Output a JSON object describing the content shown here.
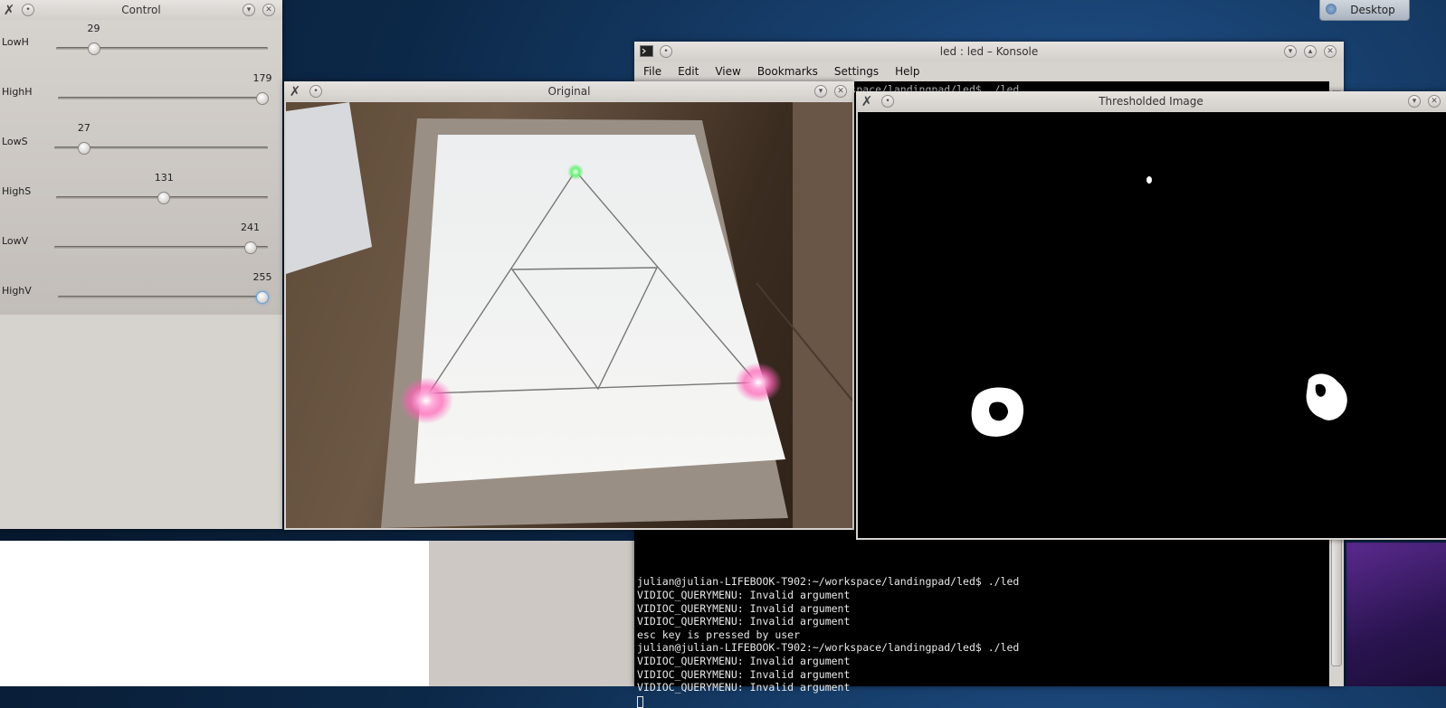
{
  "desktop": {
    "button_label": "Desktop"
  },
  "control": {
    "title": "Control",
    "sliders": [
      {
        "name": "LowH",
        "value": "29",
        "fraction": 0.16
      },
      {
        "name": "HighH",
        "value": "179",
        "fraction": 1.0
      },
      {
        "name": "LowS",
        "value": "27",
        "fraction": 0.12
      },
      {
        "name": "HighS",
        "value": "131",
        "fraction": 0.51
      },
      {
        "name": "LowV",
        "value": "241",
        "fraction": 0.94
      },
      {
        "name": "HighV",
        "value": "255",
        "fraction": 1.0
      }
    ]
  },
  "konsole": {
    "title": "led : led – Konsole",
    "menu": [
      "File",
      "Edit",
      "View",
      "Bookmarks",
      "Settings",
      "Help"
    ],
    "partial_line": "julian@julian-LIFEBOOK-T902:~/workspace/landingpad/led$ ./led",
    "lines": [
      "julian@julian-LIFEBOOK-T902:~/workspace/landingpad/led$ ./led",
      "VIDIOC_QUERYMENU: Invalid argument",
      "VIDIOC_QUERYMENU: Invalid argument",
      "VIDIOC_QUERYMENU: Invalid argument",
      "esc key is pressed by user",
      "julian@julian-LIFEBOOK-T902:~/workspace/landingpad/led$ ./led",
      "VIDIOC_QUERYMENU: Invalid argument",
      "VIDIOC_QUERYMENU: Invalid argument",
      "VIDIOC_QUERYMENU: Invalid argument"
    ]
  },
  "original": {
    "title": "Original"
  },
  "thresholded": {
    "title": "Thresholded Image"
  },
  "colors": {
    "desktop_bg": "#0c2848",
    "window_bg": "#d6d2ce",
    "terminal_bg": "#000000",
    "terminal_fg": "#e8e8e8",
    "threshold_blob": "#ffffff",
    "led_pink": "#ff6ec0",
    "led_green": "#7cff8a"
  },
  "icons": {
    "app_icon": "x-icon",
    "minimize": "chevron-down-icon",
    "maximize": "chevron-up-icon",
    "close": "close-icon",
    "pin": "circle-icon",
    "terminal": "terminal-icon"
  }
}
